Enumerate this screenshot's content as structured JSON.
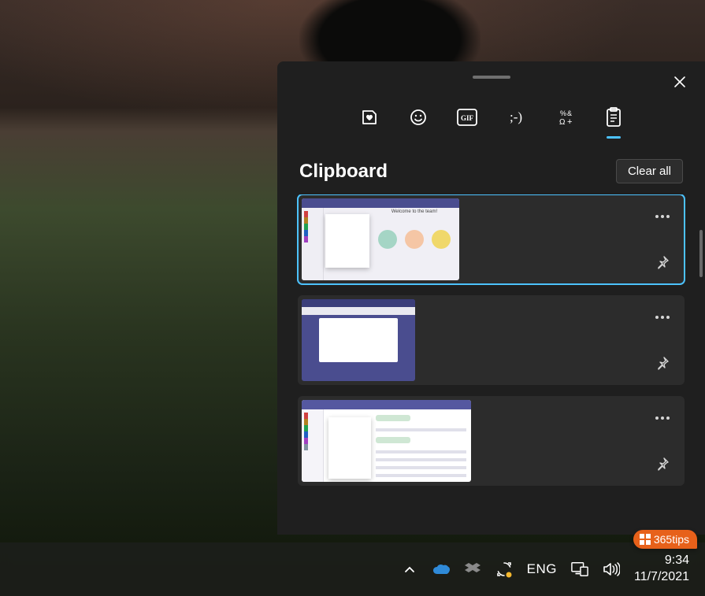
{
  "panel": {
    "title": "Clipboard",
    "clear_label": "Clear all",
    "tabs": [
      {
        "name": "stickers",
        "active": false
      },
      {
        "name": "emoji",
        "active": false
      },
      {
        "name": "gif",
        "active": false
      },
      {
        "name": "kaomoji",
        "active": false
      },
      {
        "name": "symbols",
        "active": false
      },
      {
        "name": "clipboard",
        "active": true
      }
    ],
    "items": [
      {
        "thumb_banner": "Welcome to the team!",
        "selected": true
      },
      {
        "thumb_banner": "",
        "selected": false
      },
      {
        "thumb_banner": "",
        "selected": false
      }
    ]
  },
  "taskbar": {
    "language": "ENG",
    "time": "9:34",
    "date": "11/7/2021"
  },
  "watermark": {
    "text": "365tips"
  }
}
